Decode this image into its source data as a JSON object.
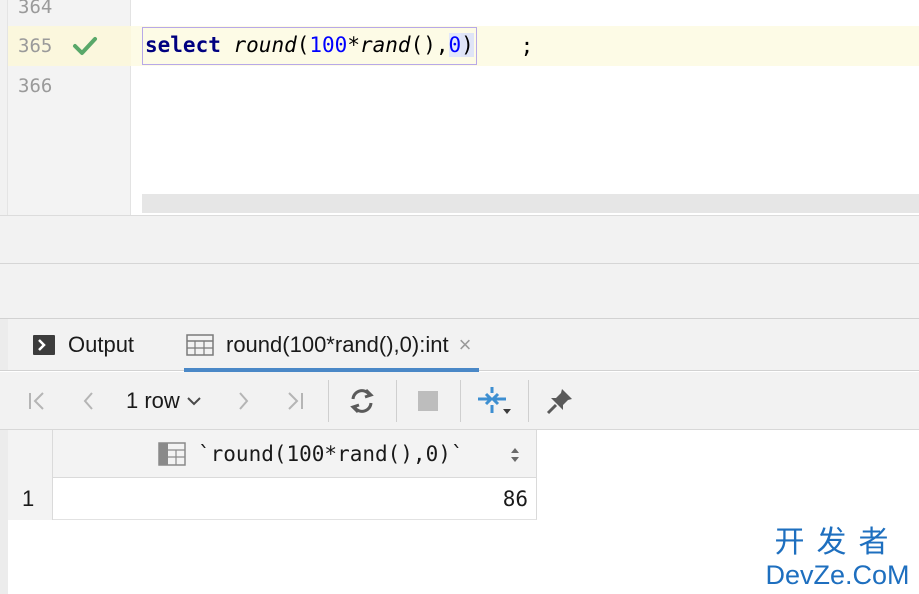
{
  "editor": {
    "line_numbers": [
      "364",
      "365",
      "366"
    ],
    "code": {
      "keyword": "select",
      "func1": "round",
      "open1": "(",
      "num1": "100",
      "op": "*",
      "func2": "rand",
      "parens2": "()",
      "comma": ",",
      "num2": "0",
      "close1": ")",
      "tail": " ;"
    }
  },
  "tabs": {
    "output_label": "Output",
    "result_label": "round(100*rand(),0):int",
    "close_glyph": "×"
  },
  "toolbar": {
    "row_count": "1 row"
  },
  "grid": {
    "column_header": "`round(100*rand(),0)`",
    "rows": [
      {
        "num": "1",
        "value": "86"
      }
    ]
  },
  "watermark": {
    "top": "开发者",
    "bottom": "DevZe.CoM"
  },
  "colors": {
    "keyword": "#000080",
    "number": "#0000ff",
    "success_check": "#59a869",
    "active_tab_underline": "#4a88c7",
    "watermark": "#1e6fbf"
  }
}
